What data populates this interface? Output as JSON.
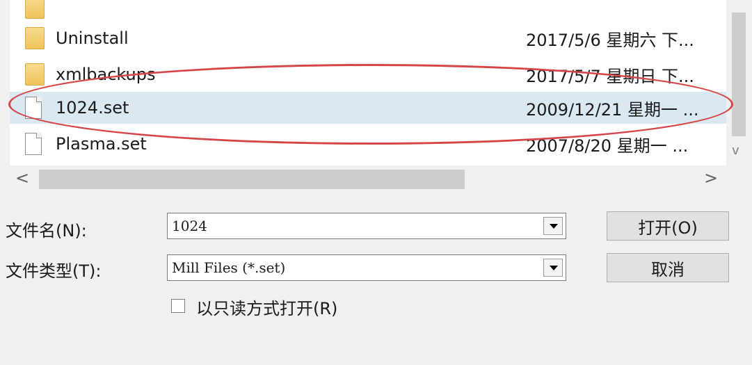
{
  "files": [
    {
      "name": "Uninstall",
      "date": "2017/5/6 星期六 下...",
      "icon": "folder-icon",
      "selected": false
    },
    {
      "name": "xmlbackups",
      "date": "2017/5/7 星期日 下...",
      "icon": "folder-icon",
      "selected": false
    },
    {
      "name": "1024.set",
      "date": "2009/12/21 星期一 ...",
      "icon": "file-icon",
      "selected": true
    },
    {
      "name": "Plasma.set",
      "date": "2007/8/20 星期一 ...",
      "icon": "file-icon",
      "selected": false
    }
  ],
  "scroll": {
    "left_arrow": "<",
    "right_arrow": ">",
    "down_arrow": "v"
  },
  "form": {
    "filename_label": "文件名(N):",
    "filename_value": "1024",
    "filetype_label": "文件类型(T):",
    "filetype_value": "Mill Files (*.set)",
    "readonly_label": "以只读方式打开(R)",
    "readonly_checked": false
  },
  "buttons": {
    "open": "打开(O)",
    "cancel": "取消"
  },
  "annotation_color": "#d64545",
  "selection_color": "#d9e8f1"
}
